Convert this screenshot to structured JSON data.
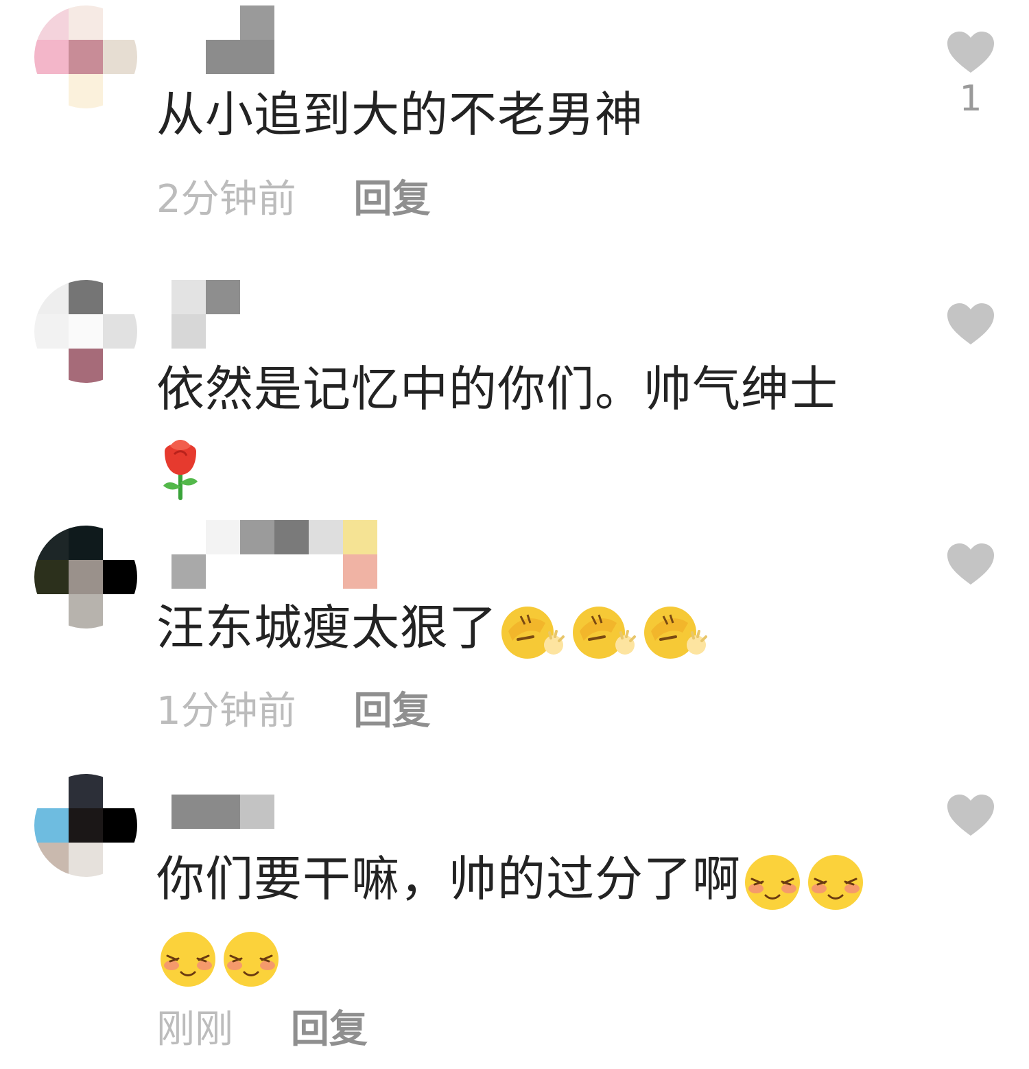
{
  "comments": [
    {
      "text": "从小追到大的不老男神",
      "time": "2分钟前",
      "reply_label": "回复",
      "like_count": "1",
      "emojis": [],
      "avatar_colors": [
        "#f4d3dc",
        "#f6eae4",
        "#ffffff",
        "#f3b6c9",
        "#c88c97",
        "#e6ddd2",
        "#ffffff",
        "#fbf1dc",
        "#ffffff"
      ],
      "username_colors": [
        "#ffffff",
        "#ffffff",
        "#9a9a9a",
        "#ffffff",
        "#ffffff",
        "#ffffff",
        "#ffffff",
        "#8c8c8c",
        "#8c8c8c",
        "#ffffff",
        "#ffffff",
        "#ffffff"
      ]
    },
    {
      "text": "依然是记忆中的你们。帅气绅士",
      "time": "",
      "reply_label": "",
      "like_count": "",
      "emojis": [
        "rose"
      ],
      "avatar_colors": [
        "#eeeeee",
        "#757575",
        "#ffffff",
        "#f2f2f2",
        "#fafafa",
        "#e1e1e1",
        "#ffffff",
        "#a66b79",
        "#ffffff"
      ],
      "username_colors": [
        "#e3e3e3",
        "#8e8e8e",
        "#ffffff",
        "#ffffff",
        "#ffffff",
        "#ffffff",
        "#d7d7d7",
        "#ffffff",
        "#ffffff",
        "#ffffff",
        "#ffffff",
        "#ffffff"
      ]
    },
    {
      "text": "汪东城瘦太狠了",
      "time": "1分钟前",
      "reply_label": "回复",
      "like_count": "",
      "emojis": [
        "facepalm",
        "facepalm",
        "facepalm"
      ],
      "avatar_colors": [
        "#1d2627",
        "#0f1a1c",
        "#ffffff",
        "#2c301c",
        "#9a918b",
        "#000000",
        "#ffffff",
        "#b7b3ad",
        "#ffffff"
      ],
      "username_colors": [
        "#ffffff",
        "#f3f3f3",
        "#9b9b9b",
        "#7a7a7a",
        "#dedede",
        "#f5e394",
        "#a9a9a9",
        "#ffffff",
        "#ffffff",
        "#ffffff",
        "#ffffff",
        "#f0b3a4"
      ]
    },
    {
      "text": "你们要干嘛，帅的过分了啊",
      "time": "刚刚",
      "reply_label": "回复",
      "like_count": "",
      "emojis": [
        "shy",
        "shy",
        "shy",
        "shy"
      ],
      "avatar_colors": [
        "#ffffff",
        "#2c2f38",
        "#ffffff",
        "#6ebce0",
        "#1b1717",
        "#000000",
        "#c9b9ae",
        "#e6e1dc",
        "#ffffff"
      ],
      "username_colors": [
        "#ffffff",
        "#ffffff",
        "#ffffff",
        "#ffffff",
        "#ffffff",
        "#ffffff",
        "#8a8a8a",
        "#8a8a8a",
        "#c3c3c3",
        "#ffffff",
        "#ffffff",
        "#ffffff"
      ]
    }
  ],
  "colors": {
    "heart": "#c4c4c4",
    "time": "#bcbcbc",
    "reply": "#8f8f8f",
    "text": "#232323"
  }
}
